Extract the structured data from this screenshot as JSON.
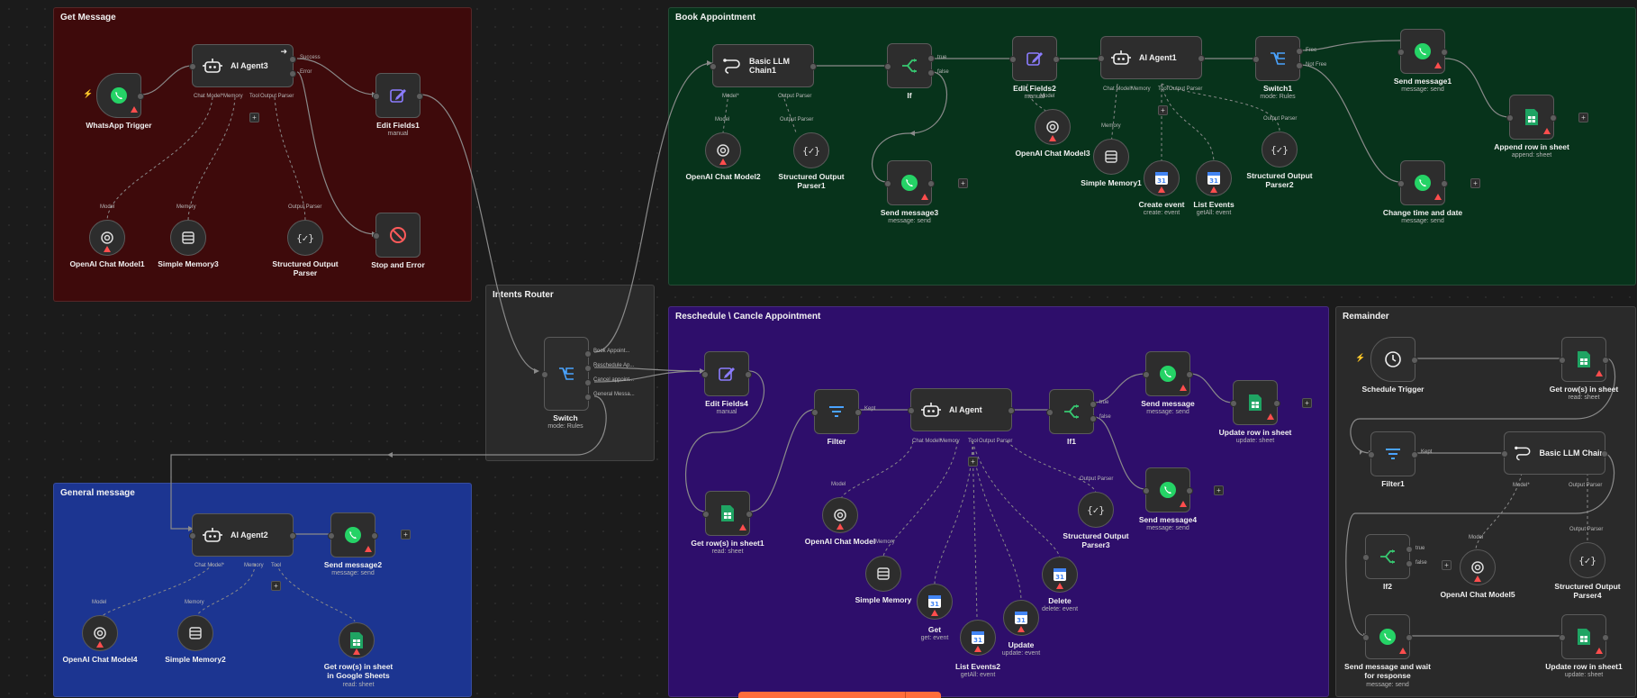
{
  "groups": {
    "get_message": "Get Message",
    "book_appointment": "Book Appointment",
    "intents_router": "Intents Router",
    "reschedule": "Reschedule \\ Cancle Appointment",
    "remainder": "Remainder",
    "general_message": "General message"
  },
  "colors": {
    "canvas": "#1b1b1b",
    "get_message": "#3e0a0b",
    "book_appointment": "#07331b",
    "intents_router": "#2a2a2a",
    "reschedule": "#2e0e6b",
    "remainder": "#2a2a2a",
    "general_message": "#1c3591",
    "accent": "#ff6d3b",
    "warning": "#ff4d4d"
  },
  "nodes": {
    "whatsapp_trigger": {
      "title": "WhatsApp Trigger",
      "icon": "whatsapp-icon"
    },
    "ai_agent3": {
      "title": "AI Agent3",
      "icon": "robot-icon",
      "outputs": [
        "Success",
        "Error"
      ],
      "ports": [
        "Chat Model*",
        "Memory",
        "Tool",
        "Output Parser"
      ]
    },
    "edit_fields1": {
      "title": "Edit Fields1",
      "sub": "manual",
      "icon": "pencil-icon"
    },
    "stop_and_error": {
      "title": "Stop and Error",
      "icon": "stop-icon"
    },
    "openai_chat_model1": {
      "title": "OpenAI Chat Model1",
      "port": "Model"
    },
    "simple_memory3": {
      "title": "Simple Memory3",
      "port": "Memory"
    },
    "structured_output_parser": {
      "title": "Structured Output",
      "title2": "Parser",
      "port": "Output Parser"
    },
    "basic_llm_chain1": {
      "title": "Basic LLM",
      "title2": "Chain1",
      "ports": [
        "Model*",
        "Output Parser"
      ]
    },
    "if_node": {
      "title": "If",
      "outputs": [
        "true",
        "false"
      ]
    },
    "edit_fields2": {
      "title": "Edit Fields2",
      "sub": "manual"
    },
    "ai_agent1": {
      "title": "AI Agent1",
      "ports": [
        "Chat Model*",
        "Memory",
        "Tool",
        "Output Parser"
      ]
    },
    "switch1": {
      "title": "Switch1",
      "sub": "mode: Rules",
      "outputs": [
        "Free",
        "Not Free"
      ]
    },
    "send_message1": {
      "title": "Send message1",
      "sub": "message: send"
    },
    "append_row": {
      "title": "Append row in sheet",
      "sub": "append: sheet"
    },
    "openai_chat_model2": {
      "title": "OpenAI Chat Model2",
      "port": "Model"
    },
    "structured_output_parser1": {
      "title": "Structured Output",
      "title2": "Parser1",
      "port": "Output Parser"
    },
    "send_message3": {
      "title": "Send message3",
      "sub": "message: send"
    },
    "openai_chat_model3": {
      "title": "OpenAI Chat Model3",
      "port": "Model"
    },
    "simple_memory1": {
      "title": "Simple Memory1",
      "port": "Memory"
    },
    "create_event": {
      "title": "Create event",
      "sub": "create: event"
    },
    "list_events": {
      "title": "List Events",
      "sub": "getAll: event"
    },
    "structured_output_parser2": {
      "title": "Structured Output",
      "title2": "Parser2",
      "port": "Output Parser"
    },
    "change_time_date": {
      "title": "Change time and date",
      "sub": "message: send"
    },
    "switch": {
      "title": "Switch",
      "sub": "mode: Rules",
      "outputs": [
        "Book Appoint...",
        "Reschedule Ap...",
        "Cancel appoint...",
        "General Messa..."
      ]
    },
    "edit_fields4": {
      "title": "Edit Fields4",
      "sub": "manual"
    },
    "filter": {
      "title": "Filter",
      "port": "Kept"
    },
    "ai_agent": {
      "title": "AI Agent",
      "ports": [
        "Chat Model*",
        "Memory",
        "Tool",
        "Output Parser"
      ]
    },
    "if1": {
      "title": "If1",
      "outputs": [
        "true",
        "false"
      ]
    },
    "send_message": {
      "title": "Send message",
      "sub": "message: send"
    },
    "update_row_sheet": {
      "title": "Update row in sheet",
      "sub": "update: sheet"
    },
    "send_message4": {
      "title": "Send message4",
      "sub": "message: send"
    },
    "get_rows_sheet1": {
      "title": "Get row(s) in sheet1",
      "sub": "read: sheet"
    },
    "openai_chat_model": {
      "title": "OpenAI Chat Model",
      "port": "Model"
    },
    "simple_memory": {
      "title": "Simple Memory",
      "port": "Memory"
    },
    "get": {
      "title": "Get",
      "sub": "get: event"
    },
    "list_events2": {
      "title": "List Events2",
      "sub": "getAll: event"
    },
    "update": {
      "title": "Update",
      "sub": "update: event"
    },
    "delete": {
      "title": "Delete",
      "sub": "delete: event"
    },
    "structured_output_parser3": {
      "title": "Structured Output",
      "title2": "Parser3",
      "port": "Output Parser"
    },
    "schedule_trigger": {
      "title": "Schedule Trigger"
    },
    "get_rows_sheet": {
      "title": "Get row(s) in sheet",
      "sub": "read: sheet"
    },
    "filter1": {
      "title": "Filter1",
      "port": "Kept"
    },
    "basic_llm_chain": {
      "title": "Basic LLM Chain",
      "ports": [
        "Model*",
        "Output Parser"
      ]
    },
    "if2": {
      "title": "If2",
      "outputs": [
        "true",
        "false"
      ]
    },
    "openai_chat_model5": {
      "title": "OpenAI Chat Model5",
      "port": "Model"
    },
    "structured_output_parser4": {
      "title": "Structured Output",
      "title2": "Parser4",
      "port": "Output Parser"
    },
    "send_and_wait": {
      "title": "Send message and wait",
      "title2": "for response",
      "sub": "message: send"
    },
    "update_row_sheet1": {
      "title": "Update row in sheet1",
      "sub": "update: sheet"
    },
    "ai_agent2": {
      "title": "AI Agent2",
      "ports": [
        "Chat Model*",
        "Memory",
        "Tool"
      ]
    },
    "send_message2": {
      "title": "Send message2",
      "sub": "message: send"
    },
    "openai_chat_model4": {
      "title": "OpenAI Chat Model4",
      "port": "Model"
    },
    "simple_memory2": {
      "title": "Simple Memory2",
      "port": "Memory"
    },
    "get_rows_google": {
      "title": "Get row(s) in sheet",
      "title2": "in Google Sheets",
      "sub": "read: sheet",
      "port": "Tool"
    }
  }
}
